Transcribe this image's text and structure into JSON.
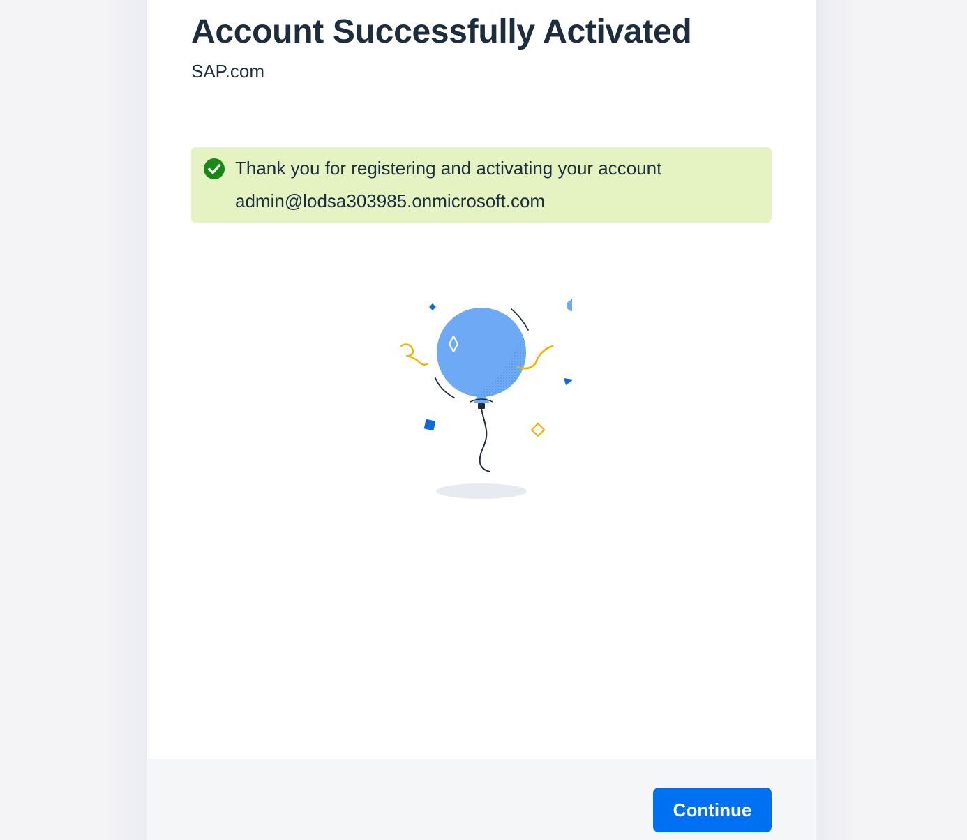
{
  "header": {
    "title": "Account Successfully Activated",
    "subtitle": "SAP.com"
  },
  "message": {
    "type": "success",
    "icon": "check-circle-icon",
    "line1": "Thank you for registering and activating your account",
    "line2": "admin@lodsa303985.onmicrosoft.com"
  },
  "illustration": {
    "icon": "balloon-icon"
  },
  "footer": {
    "continue_label": "Continue"
  },
  "colors": {
    "accent": "#0070f2",
    "success": "#188918",
    "success_background": "#e5f3c3",
    "text": "#1d2d3e"
  }
}
